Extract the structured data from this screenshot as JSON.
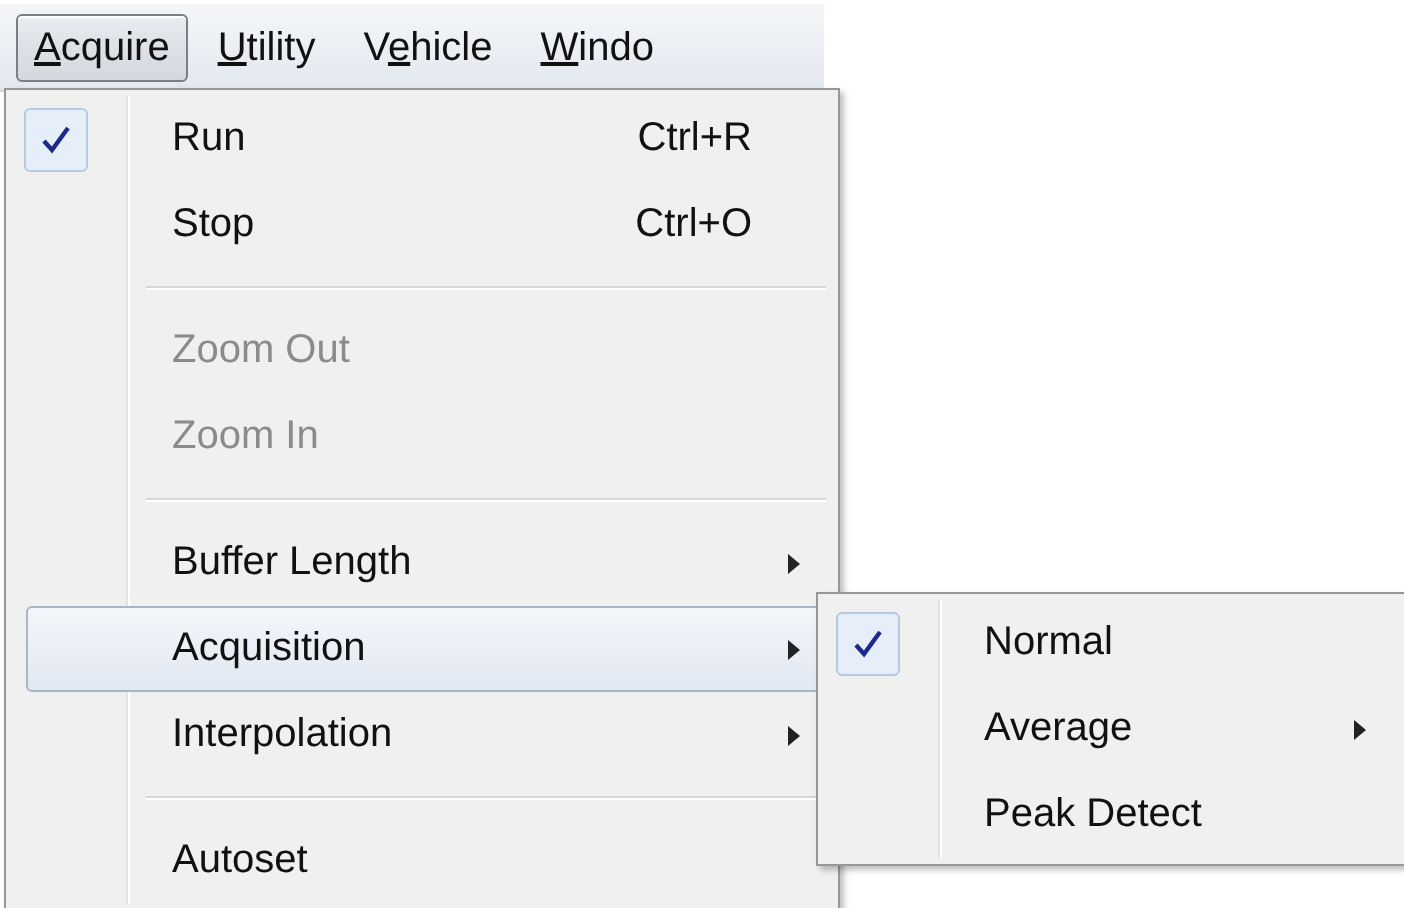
{
  "menu_bar": [
    {
      "access_key": "A",
      "after_key": "cquire",
      "selected": true
    },
    {
      "access_key": "U",
      "after_key": "tility",
      "selected": false
    },
    {
      "before_key": "V",
      "access_key": "e",
      "after_key": "hicle",
      "selected": false
    },
    {
      "access_key": "W",
      "after_key": "indo",
      "selected": false
    }
  ],
  "menu": {
    "items": [
      {
        "kind": "item",
        "label": "Run",
        "shortcut": "Ctrl+R",
        "checked": true,
        "disabled": false,
        "selected": false,
        "has_submenu": false
      },
      {
        "kind": "item",
        "label": "Stop",
        "shortcut": "Ctrl+O",
        "checked": false,
        "disabled": false,
        "selected": false,
        "has_submenu": false
      },
      {
        "kind": "separator"
      },
      {
        "kind": "item",
        "label": "Zoom Out",
        "checked": false,
        "disabled": true,
        "selected": false,
        "has_submenu": false
      },
      {
        "kind": "item",
        "label": "Zoom In",
        "checked": false,
        "disabled": true,
        "selected": false,
        "has_submenu": false
      },
      {
        "kind": "separator"
      },
      {
        "kind": "item",
        "label": "Buffer Length",
        "checked": false,
        "disabled": false,
        "selected": false,
        "has_submenu": true
      },
      {
        "kind": "item",
        "label": "Acquisition",
        "checked": false,
        "disabled": false,
        "selected": true,
        "has_submenu": true
      },
      {
        "kind": "item",
        "label": "Interpolation",
        "checked": false,
        "disabled": false,
        "selected": false,
        "has_submenu": true
      },
      {
        "kind": "separator"
      },
      {
        "kind": "item",
        "label": "Autoset",
        "checked": false,
        "disabled": false,
        "selected": false,
        "has_submenu": false
      }
    ]
  },
  "submenu": {
    "items": [
      {
        "kind": "item",
        "label": "Normal",
        "checked": true,
        "disabled": false,
        "selected": false,
        "has_submenu": false
      },
      {
        "kind": "item",
        "label": "Average",
        "checked": false,
        "disabled": false,
        "selected": false,
        "has_submenu": true
      },
      {
        "kind": "item",
        "label": "Peak Detect",
        "checked": false,
        "disabled": false,
        "selected": false,
        "has_submenu": false
      }
    ]
  }
}
